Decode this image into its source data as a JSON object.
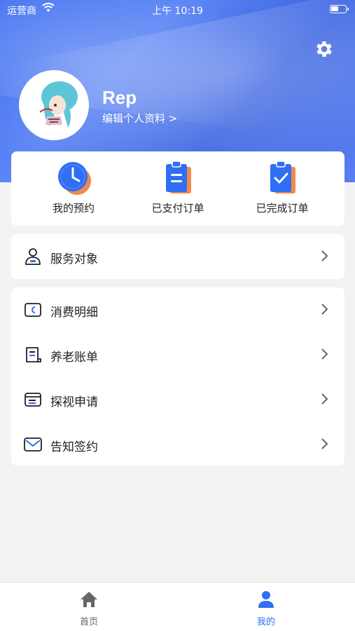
{
  "status": {
    "carrier": "运营商",
    "time": "上午 10:19"
  },
  "profile": {
    "name": "Rep",
    "edit_label": "编辑个人资料 >"
  },
  "orders": [
    {
      "label": "我的预约",
      "icon": "clock-icon"
    },
    {
      "label": "已支付订单",
      "icon": "clipboard-list-icon"
    },
    {
      "label": "已完成订单",
      "icon": "clipboard-check-icon"
    }
  ],
  "menu_primary": [
    {
      "label": "服务对象",
      "icon": "person-icon"
    }
  ],
  "menu_secondary": [
    {
      "label": "消费明细",
      "icon": "wallet-icon"
    },
    {
      "label": "养老账单",
      "icon": "receipt-icon"
    },
    {
      "label": "探视申请",
      "icon": "folder-icon"
    },
    {
      "label": "告知签约",
      "icon": "mail-icon"
    }
  ],
  "tabs": [
    {
      "label": "首页",
      "icon": "home-icon",
      "active": false
    },
    {
      "label": "我的",
      "icon": "user-icon",
      "active": true
    }
  ],
  "colors": {
    "accent": "#2f6ef5",
    "tab_inactive": "#666666",
    "orange": "#f08a4b"
  }
}
